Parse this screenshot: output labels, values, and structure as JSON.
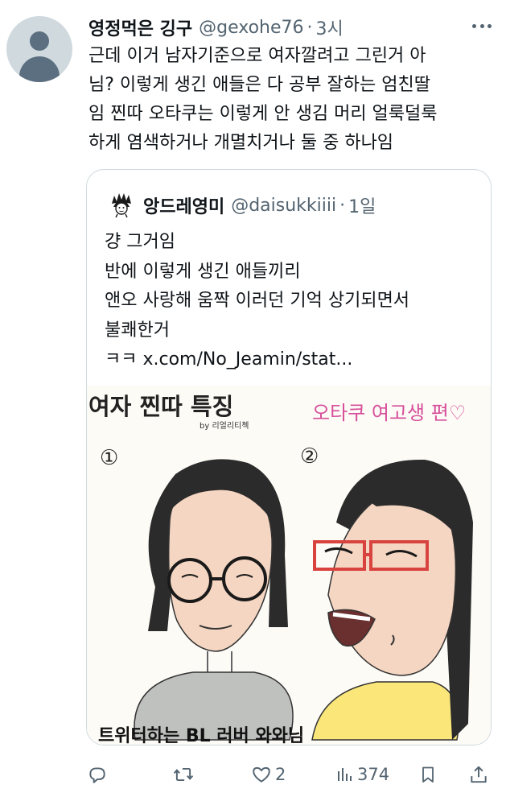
{
  "tweet": {
    "display_name": "영정먹은 깅구",
    "handle": "@gexohe76",
    "separator": "·",
    "time": "3시",
    "lines": [
      "근데 이거 남자기준으로 여자깔려고 그린거 아",
      "님? 이렇게 생긴 애들은 다 공부 잘하는 엄친딸",
      "임 찐따 오타쿠는 이렇게 안 생김 머리 얼룩덜룩",
      "하게 염색하거나 개멸치거나 둘 중 하나임"
    ]
  },
  "quote": {
    "display_name": "앙드레영미",
    "handle": "@daisukkiiii",
    "separator": "·",
    "time": "1일",
    "lines": [
      "걍 그거임",
      "반에 이렇게 생긴 애들끼리",
      "앤오 사랑해 움짝 이러던 기억 상기되면서",
      "불쾌한거",
      "ㅋㅋ x.com/No_Jeamin/stat..."
    ],
    "image": {
      "title": "여자 찐따 특징",
      "byline": "by 리얼리티첵",
      "label_1": "①",
      "label_2": "②",
      "caption_2": "오타쿠 여고생 편♡",
      "bottom_caption": "트위터하는 BL 러버 와와님"
    }
  },
  "actions": {
    "reply_count": "",
    "retweet_count": "",
    "like_count": "2",
    "view_count": "374"
  },
  "colors": {
    "text_primary": "#0f1419",
    "text_secondary": "#536471",
    "border": "#cfd9de",
    "glasses_red": "#d9433f",
    "caption_pink": "#d64f9a"
  }
}
